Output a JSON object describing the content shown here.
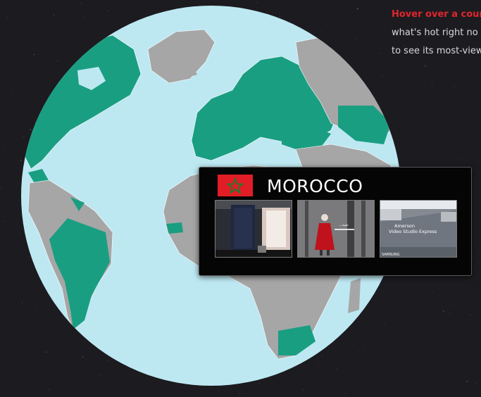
{
  "intro": {
    "highlight": "Hover over a cour",
    "line2": "what's hot right no",
    "line3": "to see its most-view"
  },
  "popup": {
    "country": "MOROCCO",
    "flag": {
      "icon": "morocco-flag-icon",
      "red": "#e11d25",
      "star": "#1f7a2e"
    },
    "videos": [
      {
        "icon": "video-thumbnail-room"
      },
      {
        "icon": "video-thumbnail-red-dress",
        "caption": "...تحية"
      },
      {
        "icon": "video-thumbnail-road",
        "overlay_line1": "Amerson",
        "overlay_line2": "Video Studio Express",
        "corner_label": "SAMSUNG"
      }
    ]
  },
  "colors": {
    "space": "#1c1b1f",
    "ocean": "#bde8f2",
    "land_highlight": "#1a9e82",
    "land_other": "#a6a6a6",
    "accent": "#e0262e"
  }
}
